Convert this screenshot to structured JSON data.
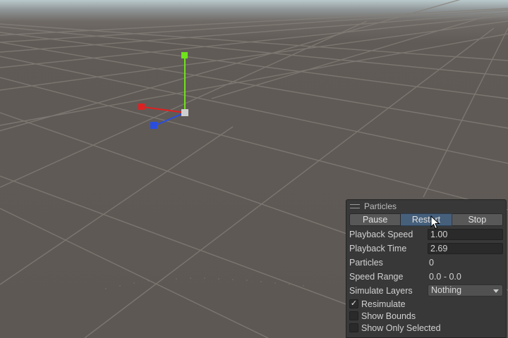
{
  "panel": {
    "title": "Particles",
    "buttons": {
      "pause": "Pause",
      "restart": "Restart",
      "stop": "Stop"
    },
    "fields": {
      "playback_speed": {
        "label": "Playback Speed",
        "value": "1.00"
      },
      "playback_time": {
        "label": "Playback Time",
        "value": "2.69"
      },
      "particles": {
        "label": "Particles",
        "value": "0"
      },
      "speed_range": {
        "label": "Speed Range",
        "value": "0.0 - 0.0"
      },
      "simulate_layers": {
        "label": "Simulate Layers",
        "value": "Nothing"
      }
    },
    "checkboxes": {
      "resimulate": {
        "label": "Resimulate",
        "checked": true,
        "mark": "✓"
      },
      "show_bounds": {
        "label": "Show Bounds",
        "checked": false
      },
      "show_only_selected": {
        "label": "Show Only Selected",
        "checked": false
      }
    }
  },
  "gizmo": {
    "x_axis_color": "#e02020",
    "y_axis_color": "#6fe31c",
    "z_axis_color": "#2a4de0",
    "center_color": "#cfcfcf"
  },
  "colors": {
    "ground": "#5e5854",
    "grid_line": "#858079",
    "panel_bg": "#383838",
    "active_button": "#46607c"
  },
  "icons": {
    "panel_grip": "grip-icon",
    "dropdown_caret": "chevron-down-icon",
    "mouse_pointer": "cursor-icon"
  }
}
